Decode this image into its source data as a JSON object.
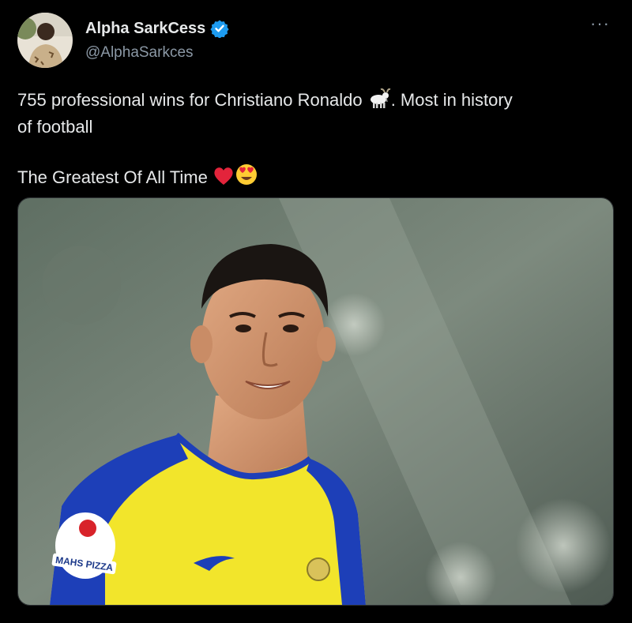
{
  "author": {
    "display_name": "Alpha SarkCess",
    "handle": "@AlphaSarkces",
    "verified": true,
    "avatar_icon": "avatar-photo"
  },
  "menu": {
    "more_label": "···"
  },
  "tweet": {
    "line1_before": "755 professional wins for Christiano Ronaldo ",
    "goat_emoji": "goat-emoji",
    "line1_after": ". Most in history",
    "line2": "of football",
    "line3": "The Greatest Of All Time ",
    "emojis": [
      "red-heart-emoji",
      "heart-eyes-emoji"
    ]
  },
  "media": {
    "description_icon": "photo",
    "jersey_sponsor": "MAHS PIZZA"
  },
  "colors": {
    "background": "#000000",
    "text": "#e7e9ea",
    "muted": "#8b98a5",
    "verified_badge": "#1d9bf0",
    "jersey_yellow": "#f2e52b",
    "jersey_blue": "#1d3fb8"
  }
}
